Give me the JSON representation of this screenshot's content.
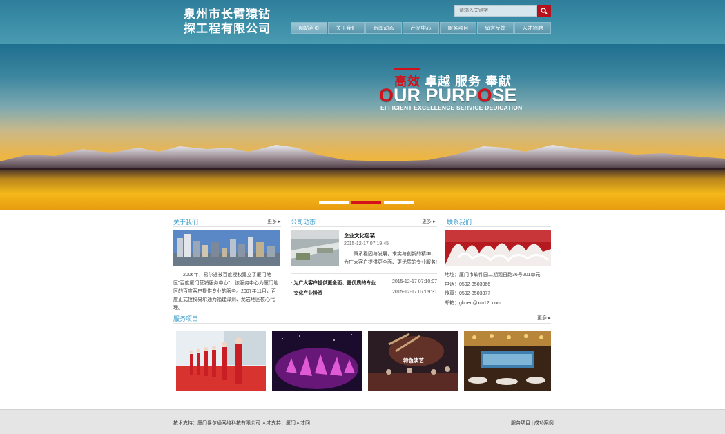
{
  "header": {
    "company_line1": "泉州市长臂猿钻",
    "company_line2": "探工程有限公司",
    "search_placeholder": "请输入关键字",
    "nav": [
      "网站首页",
      "关于我们",
      "新闻动态",
      "产品中心",
      "服务项目",
      "留言反馈",
      "人才招聘"
    ],
    "active_nav": "网站首页"
  },
  "banner": {
    "cn_red": "高效",
    "cn_rest": " 卓越 服务 奉献",
    "en_o1": "O",
    "en_mid": "UR PURP",
    "en_o2": "O",
    "en_end": "SE",
    "subtitle": "EFFICIENT EXCELLENCE SERVICE DEDICATION",
    "slide_count": 3,
    "active_slide": 2
  },
  "about": {
    "title": "关于我们",
    "more": "更多",
    "text": "2006年，易尔通被百度授权建立了厦门地区\"百度厦门营销服务中心\"，该服务中心为厦门地区的百度客户提供专业的服务。2007年11月，百度正式授权易尔通为福建漳州、龙岩地区核心代理。"
  },
  "news": {
    "title": "公司动态",
    "more": "更多",
    "featured_title": "企业文化包装",
    "featured_date": "2015-12-17 07:19:45",
    "featured_text": "秉承稳固与发展，求实与创新的精神，为广大客户提供更全面、更优质的专业服务!",
    "list": [
      {
        "title": "为广大客户提供更全面、更优质的专业",
        "date": "2015-12-17 07:10:07"
      },
      {
        "title": "文化产业投资",
        "date": "2015-12-17 07:09:31"
      }
    ]
  },
  "contact": {
    "title": "联系我们",
    "address": "地址：厦门市软件园二期观日路36号201单元",
    "phone": "电话：0592-3503966",
    "fax": "传真：0592-3503377",
    "email": "邮箱：gbpen@xm12t.com"
  },
  "services": {
    "title": "服务项目",
    "more": "更多",
    "items": [
      "",
      "",
      "特色演艺",
      ""
    ]
  },
  "footer": {
    "left": "技术支持：厦门易尔通网络科技有限公司 人才支持：厦门人才网",
    "right": "服务项目 | 成功案例"
  },
  "colors": {
    "accent_red": "#d3111a",
    "title_blue": "#3a9ccb",
    "header_teal": "#3c8fa8"
  }
}
